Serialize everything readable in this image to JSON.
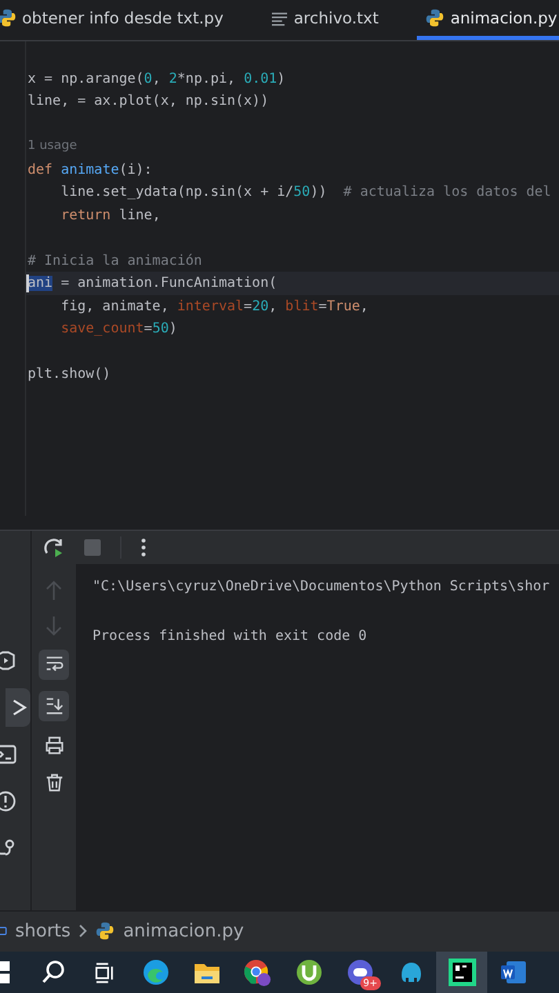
{
  "tabs": [
    {
      "label": "obtener info desde txt.py",
      "kind": "python",
      "selected": false
    },
    {
      "label": "archivo.txt",
      "kind": "text",
      "selected": false
    },
    {
      "label": "animacion.py",
      "kind": "python",
      "selected": true
    }
  ],
  "code": [
    {
      "kind": "blank"
    },
    {
      "kind": "code",
      "tokens": [
        {
          "text": "x = np.arange(",
          "kind": "plain"
        },
        {
          "text": "0",
          "kind": "num"
        },
        {
          "text": ", ",
          "kind": "plain"
        },
        {
          "text": "2",
          "kind": "num"
        },
        {
          "text": "*np.pi, ",
          "kind": "plain"
        },
        {
          "text": "0.01",
          "kind": "num"
        },
        {
          "text": ")",
          "kind": "plain"
        }
      ]
    },
    {
      "kind": "code",
      "tokens": [
        {
          "text": "line, = ax.plot(x, np.sin(x))",
          "kind": "plain"
        }
      ]
    },
    {
      "kind": "blank"
    },
    {
      "kind": "hint",
      "text": "1 usage"
    },
    {
      "kind": "code",
      "tokens": [
        {
          "text": "def ",
          "kind": "kw"
        },
        {
          "text": "animate",
          "kind": "fn"
        },
        {
          "text": "(i):",
          "kind": "plain"
        }
      ]
    },
    {
      "kind": "code",
      "tokens": [
        {
          "text": "    line.set_ydata(np.sin(x + i/",
          "kind": "plain"
        },
        {
          "text": "50",
          "kind": "num"
        },
        {
          "text": "))  ",
          "kind": "plain"
        },
        {
          "text": "# actualiza los datos del",
          "kind": "com"
        }
      ]
    },
    {
      "kind": "code",
      "tokens": [
        {
          "text": "    return",
          "kind": "kw"
        },
        {
          "text": " line,",
          "kind": "plain"
        }
      ]
    },
    {
      "kind": "blank"
    },
    {
      "kind": "code",
      "tokens": [
        {
          "text": "# Inicia la animación",
          "kind": "com"
        }
      ]
    },
    {
      "kind": "code",
      "current": true,
      "tokens": [
        {
          "text": "ani",
          "kind": "sel"
        },
        {
          "text": " = animation.FuncAnimation(",
          "kind": "plain"
        }
      ]
    },
    {
      "kind": "code",
      "tokens": [
        {
          "text": "    fig, animate, ",
          "kind": "plain"
        },
        {
          "text": "interval",
          "kind": "param"
        },
        {
          "text": "=",
          "kind": "plain"
        },
        {
          "text": "20",
          "kind": "num"
        },
        {
          "text": ", ",
          "kind": "plain"
        },
        {
          "text": "blit",
          "kind": "param"
        },
        {
          "text": "=",
          "kind": "plain"
        },
        {
          "text": "True",
          "kind": "kw"
        },
        {
          "text": ",",
          "kind": "plain"
        }
      ]
    },
    {
      "kind": "code",
      "tokens": [
        {
          "text": "    save_count",
          "kind": "param"
        },
        {
          "text": "=",
          "kind": "plain"
        },
        {
          "text": "50",
          "kind": "num"
        },
        {
          "text": ")",
          "kind": "plain"
        }
      ]
    },
    {
      "kind": "blank"
    },
    {
      "kind": "code",
      "tokens": [
        {
          "text": "plt.show()",
          "kind": "plain"
        }
      ]
    }
  ],
  "console": {
    "lines": [
      "\"C:\\Users\\cyruz\\OneDrive\\Documentos\\Python Scripts\\shor",
      "Process finished with exit code 0"
    ]
  },
  "breadcrumb": [
    {
      "label": "shorts",
      "kind": "folder"
    },
    {
      "label": "animacion.py",
      "kind": "python"
    }
  ],
  "taskbar": [
    {
      "kind": "start"
    },
    {
      "kind": "search"
    },
    {
      "kind": "taskview"
    },
    {
      "kind": "edge"
    },
    {
      "kind": "explorer"
    },
    {
      "kind": "chrome"
    },
    {
      "kind": "torrent"
    },
    {
      "kind": "chat",
      "badge": "9+"
    },
    {
      "kind": "elephant"
    },
    {
      "kind": "pycharm",
      "selected": true
    },
    {
      "kind": "word",
      "selected": false
    }
  ]
}
